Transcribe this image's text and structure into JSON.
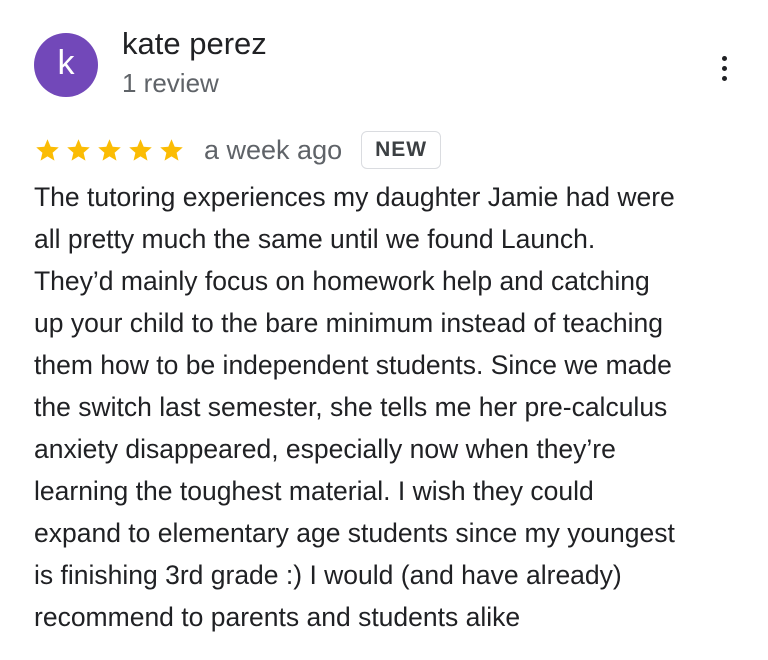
{
  "author": {
    "name": "kate perez",
    "initial": "k",
    "avatar_color": "#7248b9",
    "review_count": "1 review"
  },
  "rating": {
    "stars": 5,
    "max_stars": 5,
    "star_color": "#fbbc04"
  },
  "meta": {
    "time_ago": "a week ago",
    "badge": "NEW"
  },
  "menu": {
    "icon": "more-vertical-icon"
  },
  "review": {
    "lines": [
      "The tutoring experiences my daughter Jamie had were",
      "all pretty much the same until we found Launch.",
      "They’d mainly focus on homework help and catching",
      "up your child to the bare minimum instead of teaching",
      "them how to be independent students. Since we made",
      "the switch last semester, she tells me her pre-calculus",
      "anxiety disappeared, especially now when they’re",
      "learning the toughest material. I wish they could",
      "expand to elementary age students since my youngest",
      "is finishing 3rd grade :) I would (and have already)",
      "recommend to parents and students alike"
    ]
  }
}
